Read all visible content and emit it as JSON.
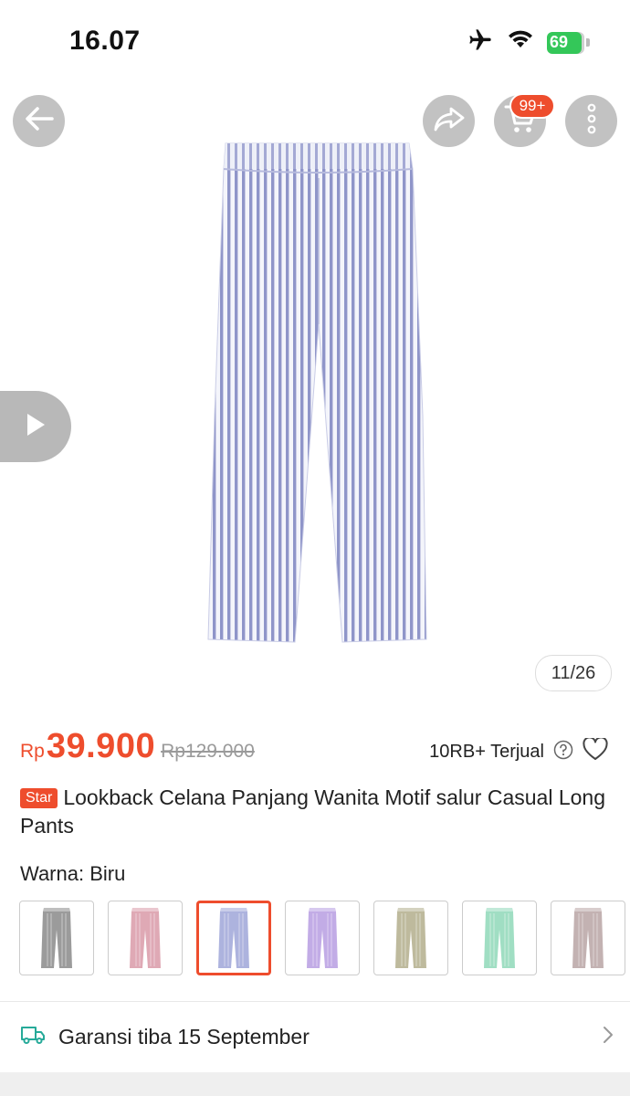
{
  "status_bar": {
    "time": "16.07",
    "battery_level": "69"
  },
  "header": {
    "cart_badge": "99+"
  },
  "gallery": {
    "page_counter": "11/26"
  },
  "price": {
    "currency": "Rp",
    "current": "39.900",
    "original": "Rp129.000"
  },
  "sales": {
    "sold_label": "10RB+ Terjual"
  },
  "product": {
    "badge": "Star",
    "title": "Lookback Celana Panjang Wanita Motif salur Casual Long Pants"
  },
  "variant": {
    "label": "Warna:",
    "selected": "Biru",
    "options": [
      {
        "name": "gray",
        "color": "#8a8a8a"
      },
      {
        "name": "pink",
        "color": "#d99aa8"
      },
      {
        "name": "blue",
        "color": "#9fa6d8"
      },
      {
        "name": "purple",
        "color": "#b79ee2"
      },
      {
        "name": "olive",
        "color": "#b3ae8c"
      },
      {
        "name": "green",
        "color": "#8fd8b8"
      },
      {
        "name": "brown",
        "color": "#b8a4a4"
      }
    ],
    "selected_index": 2
  },
  "shipping": {
    "text": "Garansi tiba 15 September"
  },
  "colors": {
    "accent": "#ee4d2d",
    "battery": "#34c759",
    "shipping_icon": "#26aa99"
  }
}
